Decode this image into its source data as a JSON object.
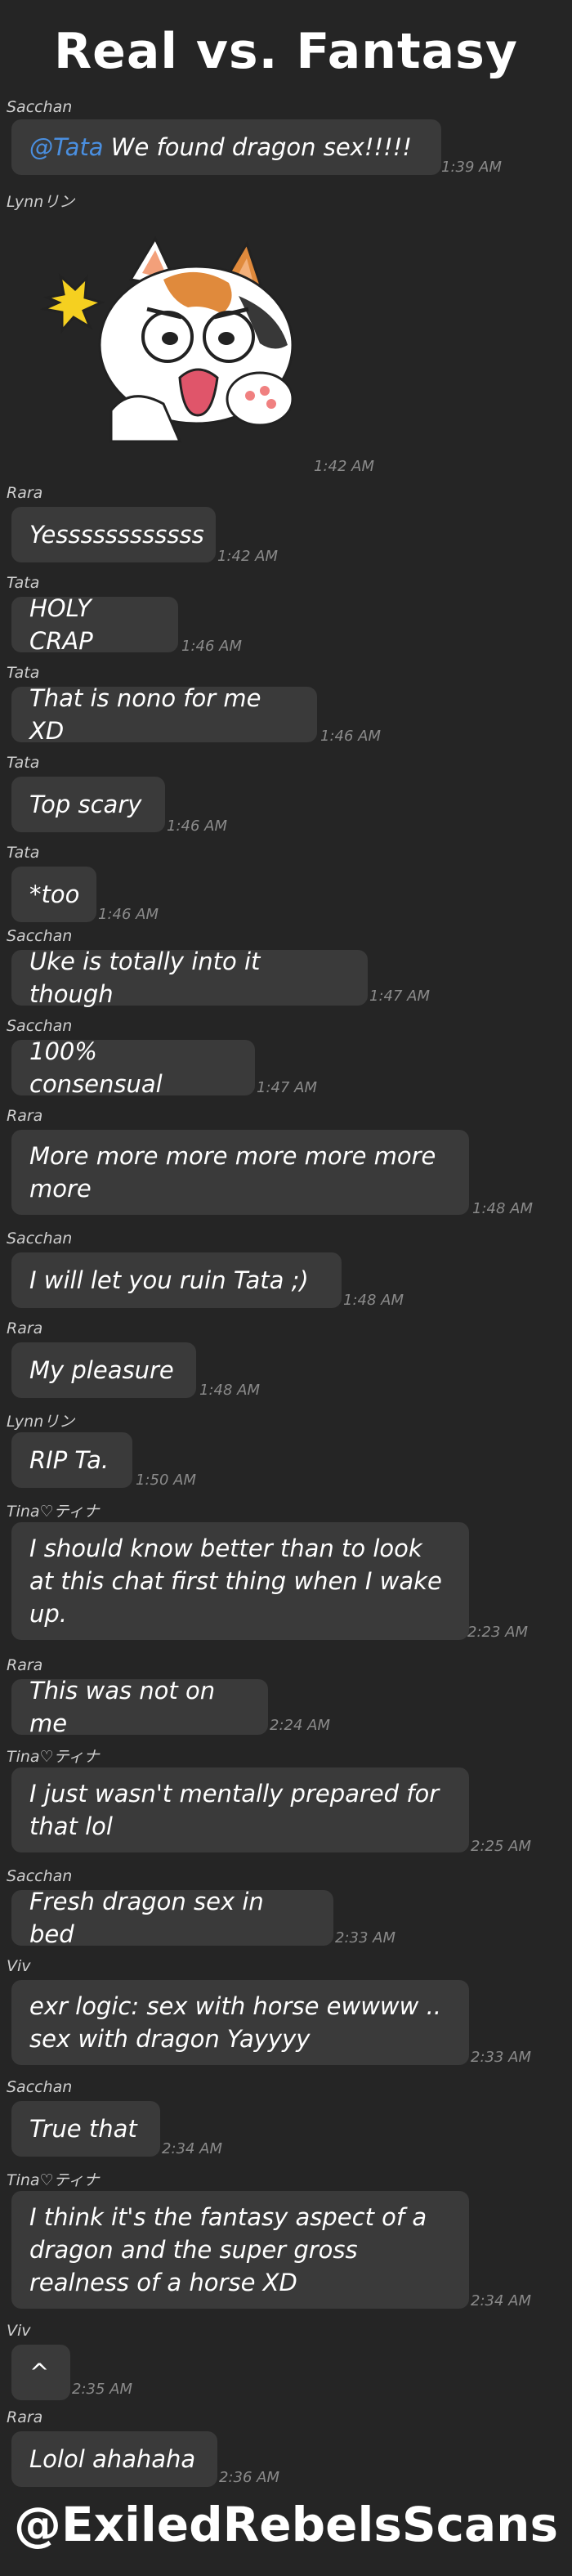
{
  "title": "Real vs. Fantasy",
  "footer": "@ExiledRebelsScans",
  "colors": {
    "background": "#252525",
    "bubble": "#3a3a3a",
    "mention": "#4a8fe0",
    "timestamp": "#8a8a8a"
  },
  "messages": [
    {
      "sender": "Sacchan",
      "mention": "@Tata",
      "text": " We found dragon sex!!!!!",
      "time": "1:39 AM"
    },
    {
      "sender": "Lynnリン",
      "sticker": "shocked-cat-sticker-icon",
      "time": "1:42 AM"
    },
    {
      "sender": "Rara",
      "text": "Yessssssssssss",
      "time": "1:42 AM"
    },
    {
      "sender": "Tata",
      "text": "HOLY CRAP",
      "time": "1:46 AM"
    },
    {
      "sender": "Tata",
      "text": "That is nono for me XD",
      "time": "1:46 AM"
    },
    {
      "sender": "Tata",
      "text": "Top scary",
      "time": "1:46 AM"
    },
    {
      "sender": "Tata",
      "text": "*too",
      "time": "1:46 AM"
    },
    {
      "sender": "Sacchan",
      "text": "Uke is totally into it though",
      "time": "1:47 AM"
    },
    {
      "sender": "Sacchan",
      "text": "100% consensual",
      "time": "1:47 AM"
    },
    {
      "sender": "Rara",
      "text": "More more more more more more more",
      "time": "1:48 AM"
    },
    {
      "sender": "Sacchan",
      "text": "I will let you ruin Tata ;)",
      "time": "1:48 AM"
    },
    {
      "sender": "Rara",
      "text": "My pleasure",
      "time": "1:48 AM"
    },
    {
      "sender": "Lynnリン",
      "text": "RIP Ta.",
      "time": "1:50 AM"
    },
    {
      "sender": "Tina♡ティナ",
      "text": "I should know better than to look at this chat first thing when I wake up.",
      "time": "2:23 AM"
    },
    {
      "sender": "Rara",
      "text": "This was not on me",
      "time": "2:24 AM"
    },
    {
      "sender": "Tina♡ティナ",
      "text": "I just wasn't mentally prepared for that lol",
      "time": "2:25 AM"
    },
    {
      "sender": "Sacchan",
      "text": "Fresh dragon sex in bed",
      "time": "2:33 AM"
    },
    {
      "sender": "Viv",
      "text": "exr logic: sex with horse ewwww .. sex with dragon Yayyyy",
      "time": "2:33 AM"
    },
    {
      "sender": "Sacchan",
      "text": "True that",
      "time": "2:34 AM"
    },
    {
      "sender": "Tina♡ティナ",
      "text": "I think it's the fantasy aspect of a dragon and the super gross realness of a horse XD",
      "time": "2:34 AM"
    },
    {
      "sender": "Viv",
      "text": "^",
      "time": "2:35 AM"
    },
    {
      "sender": "Rara",
      "text": "Lolol ahahaha",
      "time": "2:36 AM"
    }
  ]
}
